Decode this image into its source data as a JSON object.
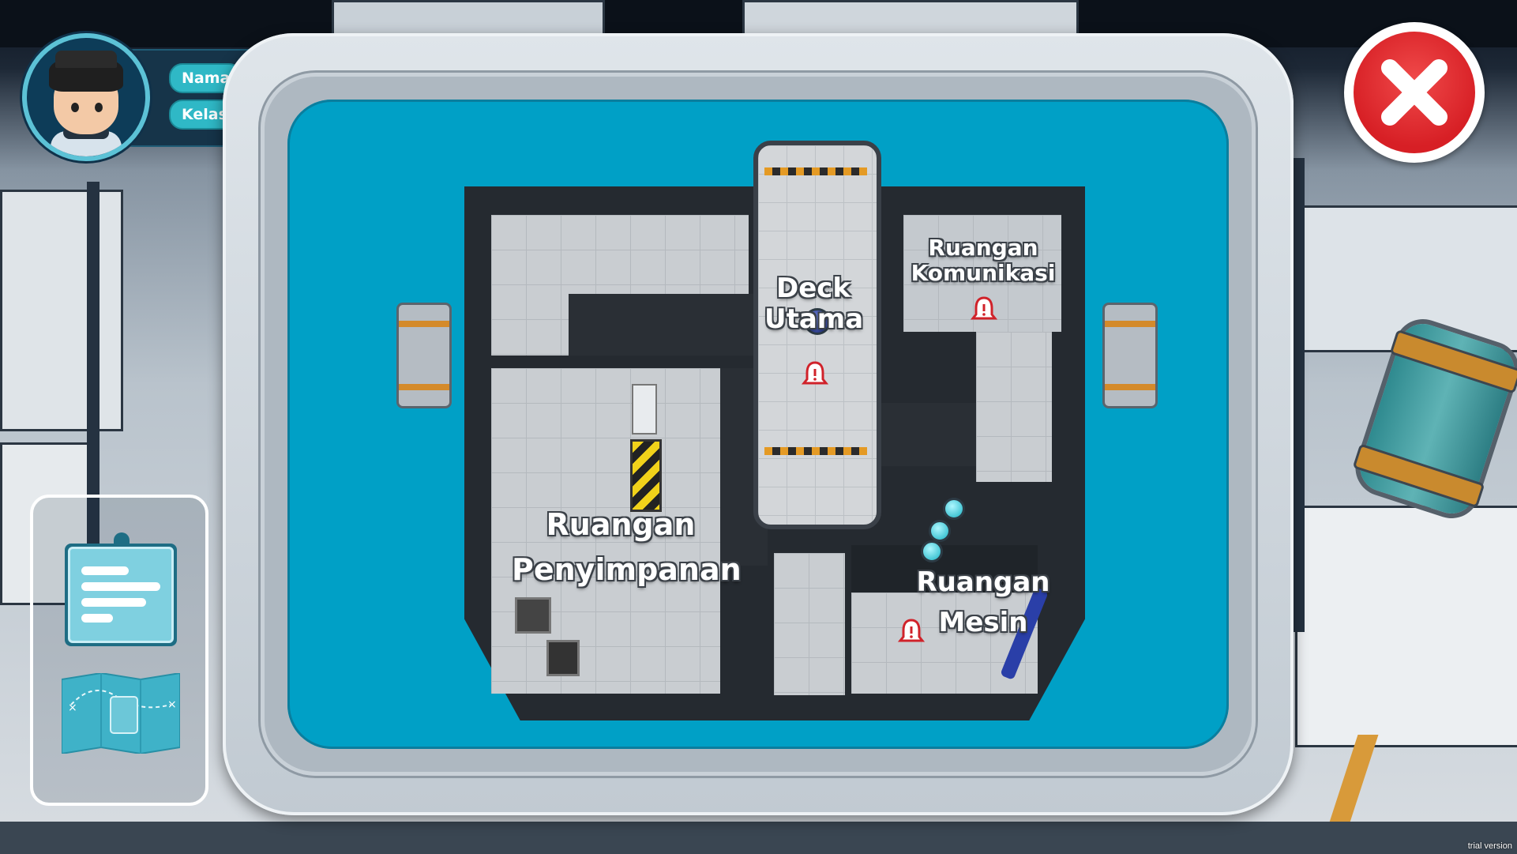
{
  "player": {
    "name_label": "Nama",
    "class_label": "Kelas"
  },
  "map": {
    "rooms": [
      {
        "id": "deck-utama",
        "lines": [
          "Deck",
          "Utama"
        ],
        "has_alert": true
      },
      {
        "id": "ruangan-komunikasi",
        "lines": [
          "Ruangan",
          "Komunikasi"
        ],
        "has_alert": true
      },
      {
        "id": "ruangan-penyimpanan",
        "lines": [
          "Ruangan",
          "Penyimpanan"
        ],
        "has_alert": false
      },
      {
        "id": "ruangan-mesin",
        "lines": [
          "Ruangan",
          "Mesin"
        ],
        "has_alert": true
      }
    ]
  },
  "side_menu": {
    "items": [
      {
        "icon": "notes-icon"
      },
      {
        "icon": "map-icon"
      }
    ]
  },
  "close": {
    "icon": "close-icon"
  },
  "watermark": "trial version",
  "colors": {
    "map_bg": "#00a0c6",
    "alert": "#d0222a",
    "accent_teal": "#2fb8c6",
    "close_red": "#d71f25"
  }
}
